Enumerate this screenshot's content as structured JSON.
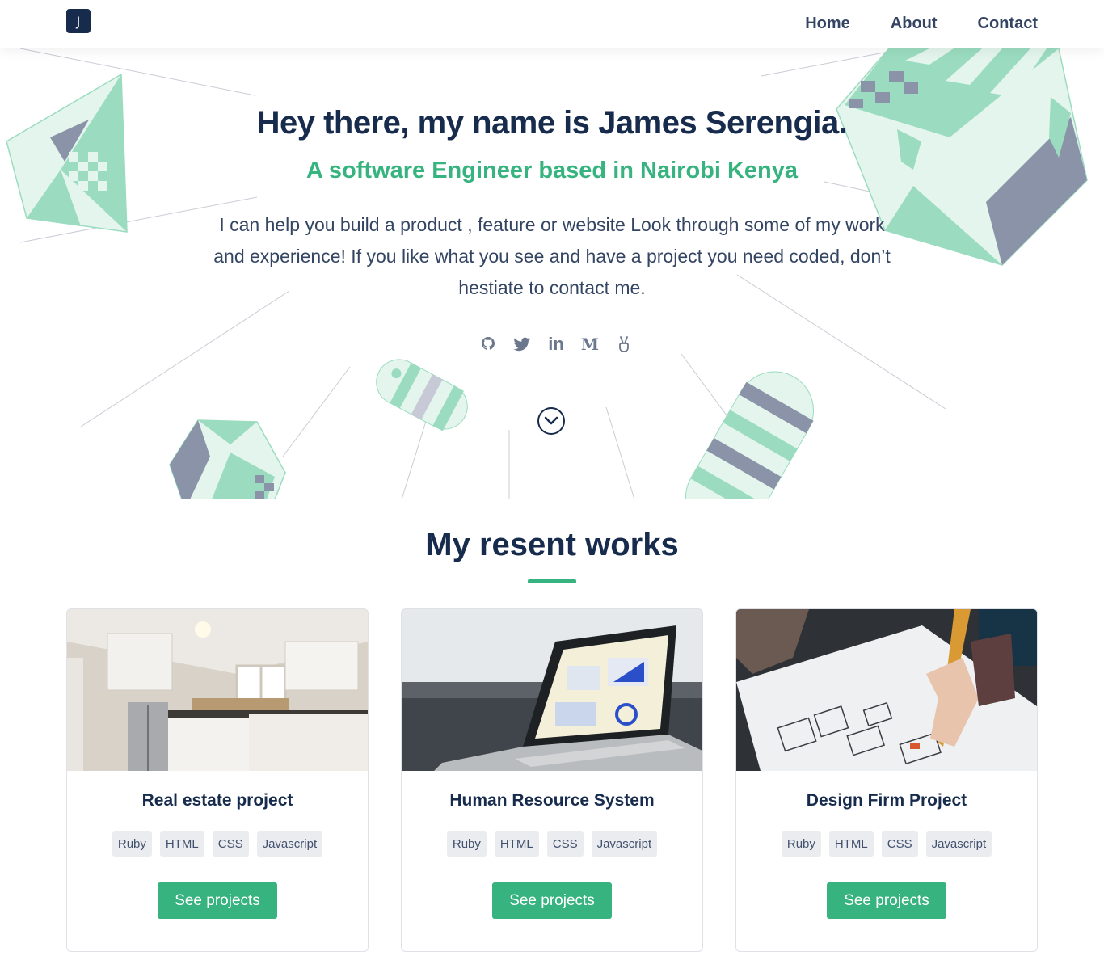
{
  "nav": {
    "logo": "J",
    "links": [
      "Home",
      "About",
      "Contact"
    ]
  },
  "hero": {
    "title": "Hey there, my name is James Serengia.",
    "subtitle": "A software Engineer based in Nairobi Kenya",
    "description": "I can help you build a product , feature or website Look through some of my work and experience! If you like what you see and have a project you need coded, don’t hestiate to contact me.",
    "socials": [
      "github-icon",
      "twitter-icon",
      "linkedin-icon",
      "medium-icon",
      "angellist-icon"
    ],
    "medium_glyph": "M",
    "linkedin_glyph": "in"
  },
  "works": {
    "title": "My resent works",
    "cards": [
      {
        "title": "Real estate project",
        "tags": [
          "Ruby",
          "HTML",
          "CSS",
          "Javascript"
        ],
        "button": "See projects"
      },
      {
        "title": "Human Resource System",
        "tags": [
          "Ruby",
          "HTML",
          "CSS",
          "Javascript"
        ],
        "button": "See projects"
      },
      {
        "title": "Design Firm Project",
        "tags": [
          "Ruby",
          "HTML",
          "CSS",
          "Javascript"
        ],
        "button": "See projects"
      }
    ]
  },
  "colors": {
    "navy": "#172b4d",
    "green": "#36b37e",
    "mint": "#9bdcc0",
    "mint_light": "#e3f5ec",
    "slate": "#8a93a8"
  }
}
